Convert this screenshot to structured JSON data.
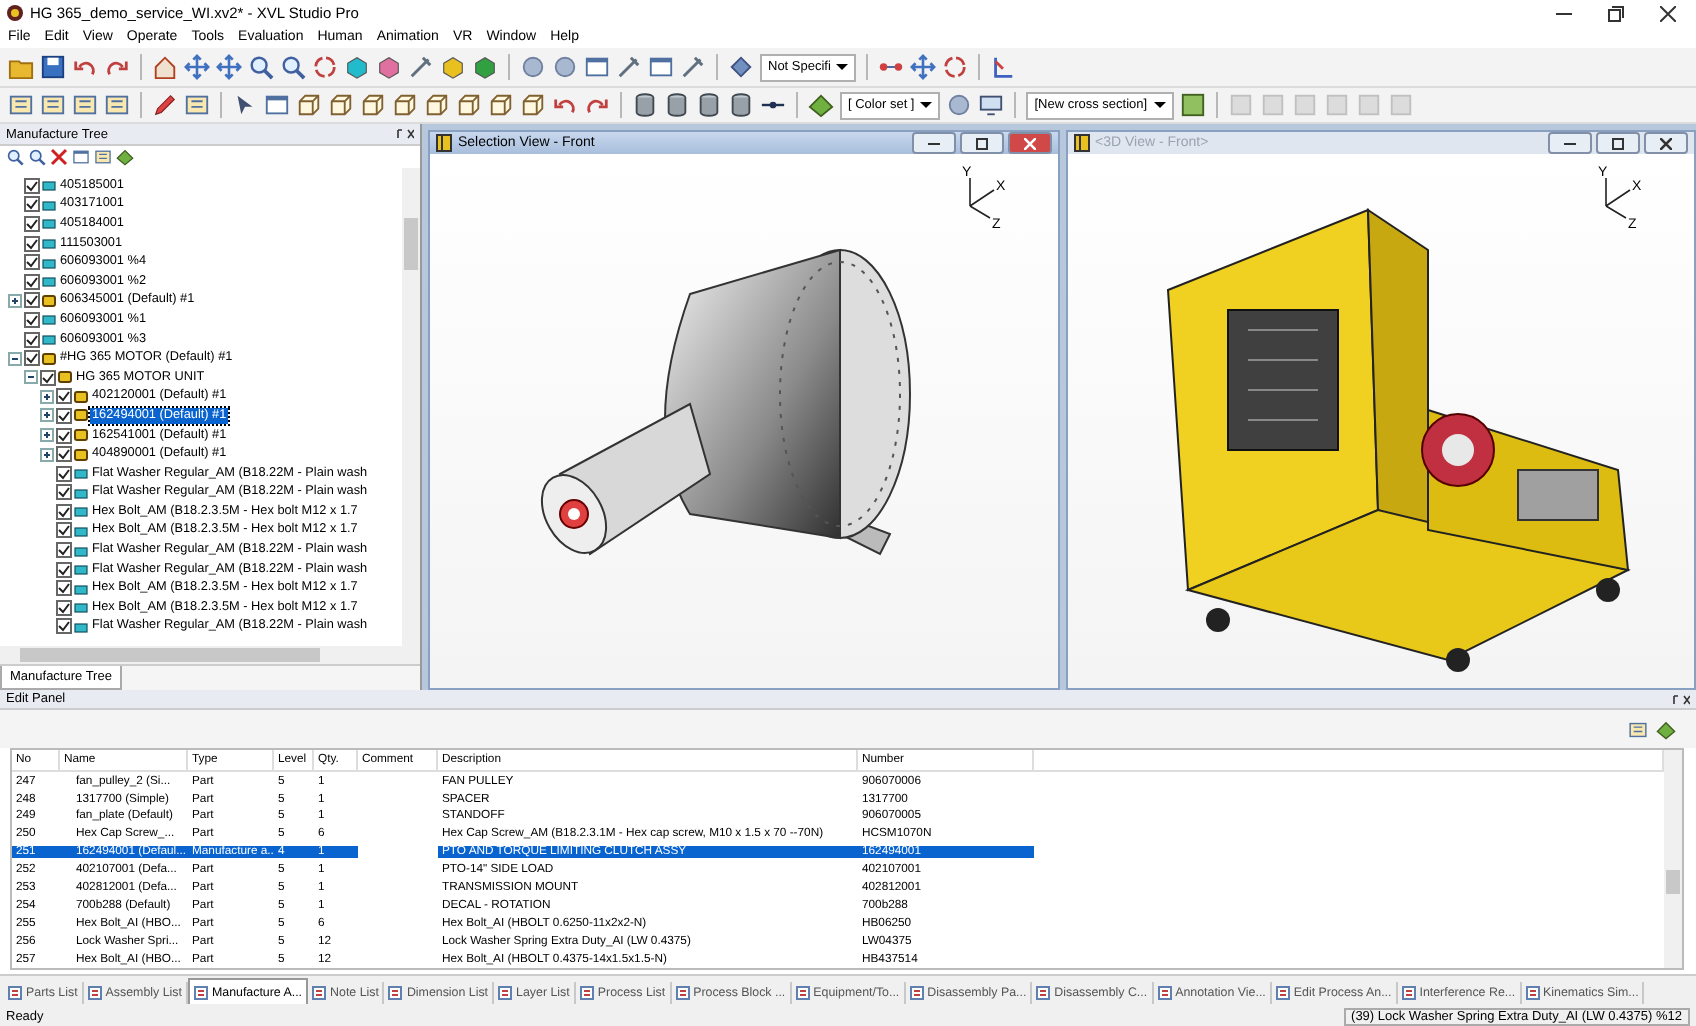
{
  "window": {
    "title": "HG 365_demo_service_WI.xv2* - XVL Studio Pro"
  },
  "menu": [
    "File",
    "Edit",
    "View",
    "Operate",
    "Tools",
    "Evaluation",
    "Human",
    "Animation",
    "VR",
    "Window",
    "Help"
  ],
  "toolbar": {
    "dropdowns": [
      "Not Specifi",
      "[ Color set ]",
      "[New cross section]"
    ]
  },
  "tree": {
    "title": "Manufacture Tree",
    "tab": "Manufacture Tree",
    "items": [
      {
        "label": "405185001",
        "kind": "part",
        "checked": true,
        "selected": false
      },
      {
        "label": "403171001",
        "kind": "part",
        "checked": true,
        "selected": false
      },
      {
        "label": "405184001",
        "kind": "part",
        "checked": true,
        "selected": false
      },
      {
        "label": "111503001",
        "kind": "part",
        "checked": true,
        "selected": false
      },
      {
        "label": "606093001 %4",
        "kind": "part",
        "checked": true,
        "selected": false
      },
      {
        "label": "606093001 %2",
        "kind": "part",
        "checked": true,
        "selected": false
      },
      {
        "label": "606345001 (Default) #1",
        "kind": "assembly",
        "checked": true,
        "selected": false,
        "expanded": false
      },
      {
        "label": "606093001 %1",
        "kind": "part",
        "checked": true,
        "selected": false
      },
      {
        "label": "606093001 %3",
        "kind": "part",
        "checked": true,
        "selected": false
      },
      {
        "label": "#HG 365 MOTOR (Default) #1",
        "kind": "assembly",
        "checked": true,
        "selected": false,
        "expanded": true,
        "children": [
          {
            "label": "HG 365 MOTOR UNIT",
            "kind": "assembly",
            "checked": true,
            "selected": false,
            "expanded": true,
            "children": [
              {
                "label": "402120001 (Default) #1",
                "kind": "assembly",
                "checked": true,
                "selected": false,
                "expanded": false
              },
              {
                "label": "162494001 (Default) #1",
                "kind": "assembly",
                "checked": true,
                "selected": true,
                "expanded": false
              },
              {
                "label": "162541001 (Default) #1",
                "kind": "assembly",
                "checked": true,
                "selected": false,
                "expanded": false
              },
              {
                "label": "404890001 (Default) #1",
                "kind": "assembly",
                "checked": true,
                "selected": false,
                "expanded": false
              },
              {
                "label": "Flat Washer Regular_AM (B18.22M - Plain wash",
                "kind": "part",
                "checked": true,
                "selected": false
              },
              {
                "label": "Flat Washer Regular_AM (B18.22M - Plain wash",
                "kind": "part",
                "checked": true,
                "selected": false
              },
              {
                "label": "Hex Bolt_AM (B18.2.3.5M - Hex bolt M12 x 1.7",
                "kind": "part",
                "checked": true,
                "selected": false
              },
              {
                "label": "Hex Bolt_AM (B18.2.3.5M - Hex bolt M12 x 1.7",
                "kind": "part",
                "checked": true,
                "selected": false
              },
              {
                "label": "Flat Washer Regular_AM (B18.22M - Plain wash",
                "kind": "part",
                "checked": true,
                "selected": false
              },
              {
                "label": "Flat Washer Regular_AM (B18.22M - Plain wash",
                "kind": "part",
                "checked": true,
                "selected": false
              },
              {
                "label": "Hex Bolt_AM (B18.2.3.5M - Hex bolt M12 x 1.7",
                "kind": "part",
                "checked": true,
                "selected": false
              },
              {
                "label": "Hex Bolt_AM (B18.2.3.5M - Hex bolt M12 x 1.7",
                "kind": "part",
                "checked": true,
                "selected": false
              },
              {
                "label": "Flat Washer Regular_AM (B18.22M - Plain wash",
                "kind": "part",
                "checked": true,
                "selected": false
              }
            ]
          }
        ]
      }
    ]
  },
  "views": [
    {
      "title": "Selection View - Front",
      "active": true,
      "kind": "motor",
      "axes": [
        "Y",
        "X",
        "Z"
      ]
    },
    {
      "title": "<3D View - Front>",
      "active": false,
      "kind": "machine",
      "axes": [
        "Y",
        "X",
        "Z"
      ]
    }
  ],
  "edit_panel": {
    "title": "Edit Panel",
    "columns": [
      "No",
      "Name",
      "Type",
      "Level",
      "Qty.",
      "Comment",
      "Description",
      "Number"
    ],
    "rows": [
      {
        "cells": [
          "247",
          "fan_pulley_2 (Si...",
          "Part",
          "5",
          "1",
          "",
          "FAN PULLEY",
          "906070006"
        ],
        "selected": false
      },
      {
        "cells": [
          "248",
          "1317700 (Simple)",
          "Part",
          "5",
          "1",
          "",
          "SPACER",
          "1317700"
        ],
        "selected": false
      },
      {
        "cells": [
          "249",
          "fan_plate (Default)",
          "Part",
          "5",
          "1",
          "",
          "STANDOFF",
          "906070005"
        ],
        "selected": false
      },
      {
        "cells": [
          "250",
          "Hex Cap Screw_...",
          "Part",
          "5",
          "6",
          "",
          "Hex Cap Screw_AM (B18.2.3.1M - Hex cap screw, M10 x 1.5 x 70 --70N)",
          "HCSM1070N"
        ],
        "selected": false
      },
      {
        "cells": [
          "251",
          "162494001 (Defaul...",
          "Manufacture a...",
          "4",
          "1",
          "",
          "PTO AND TORQUE LIMITING CLUTCH ASSY",
          "162494001"
        ],
        "selected": true
      },
      {
        "cells": [
          "252",
          "402107001 (Defa...",
          "Part",
          "5",
          "1",
          "",
          "PTO-14\" SIDE LOAD",
          "402107001"
        ],
        "selected": false
      },
      {
        "cells": [
          "253",
          "402812001 (Defa...",
          "Part",
          "5",
          "1",
          "",
          "TRANSMISSION MOUNT",
          "402812001"
        ],
        "selected": false
      },
      {
        "cells": [
          "254",
          "700b288 (Default)",
          "Part",
          "5",
          "1",
          "",
          "DECAL - ROTATION",
          "700b288"
        ],
        "selected": false
      },
      {
        "cells": [
          "255",
          "Hex Bolt_AI (HBO...",
          "Part",
          "5",
          "6",
          "",
          "Hex Bolt_AI (HBOLT 0.6250-11x2x2-N)",
          "HB06250"
        ],
        "selected": false
      },
      {
        "cells": [
          "256",
          "Lock Washer Spri...",
          "Part",
          "5",
          "12",
          "",
          "Lock Washer Spring Extra Duty_AI (LW 0.4375)",
          "LW04375"
        ],
        "selected": false
      },
      {
        "cells": [
          "257",
          "Hex Bolt_AI (HBO...",
          "Part",
          "5",
          "12",
          "",
          "Hex Bolt_AI (HBOLT 0.4375-14x1.5x1.5-N)",
          "HB437514"
        ],
        "selected": false
      }
    ]
  },
  "bottom_tabs": [
    {
      "label": "Parts List",
      "selected": false
    },
    {
      "label": "Assembly List",
      "selected": false
    },
    {
      "label": "Manufacture A...",
      "selected": true
    },
    {
      "label": "Note List",
      "selected": false
    },
    {
      "label": "Dimension List",
      "selected": false
    },
    {
      "label": "Layer List",
      "selected": false
    },
    {
      "label": "Process List",
      "selected": false
    },
    {
      "label": "Process Block ...",
      "selected": false
    },
    {
      "label": "Equipment/To...",
      "selected": false
    },
    {
      "label": "Disassembly Pa...",
      "selected": false
    },
    {
      "label": "Disassembly C...",
      "selected": false
    },
    {
      "label": "Annotation Vie...",
      "selected": false
    },
    {
      "label": "Edit Process An...",
      "selected": false
    },
    {
      "label": "Interference Re...",
      "selected": false
    },
    {
      "label": "Kinematics Sim...",
      "selected": false
    }
  ],
  "status_bar": {
    "left": "Ready",
    "right": "(39) Lock Washer Spring Extra Duty_AI (LW 0.4375) %12"
  }
}
